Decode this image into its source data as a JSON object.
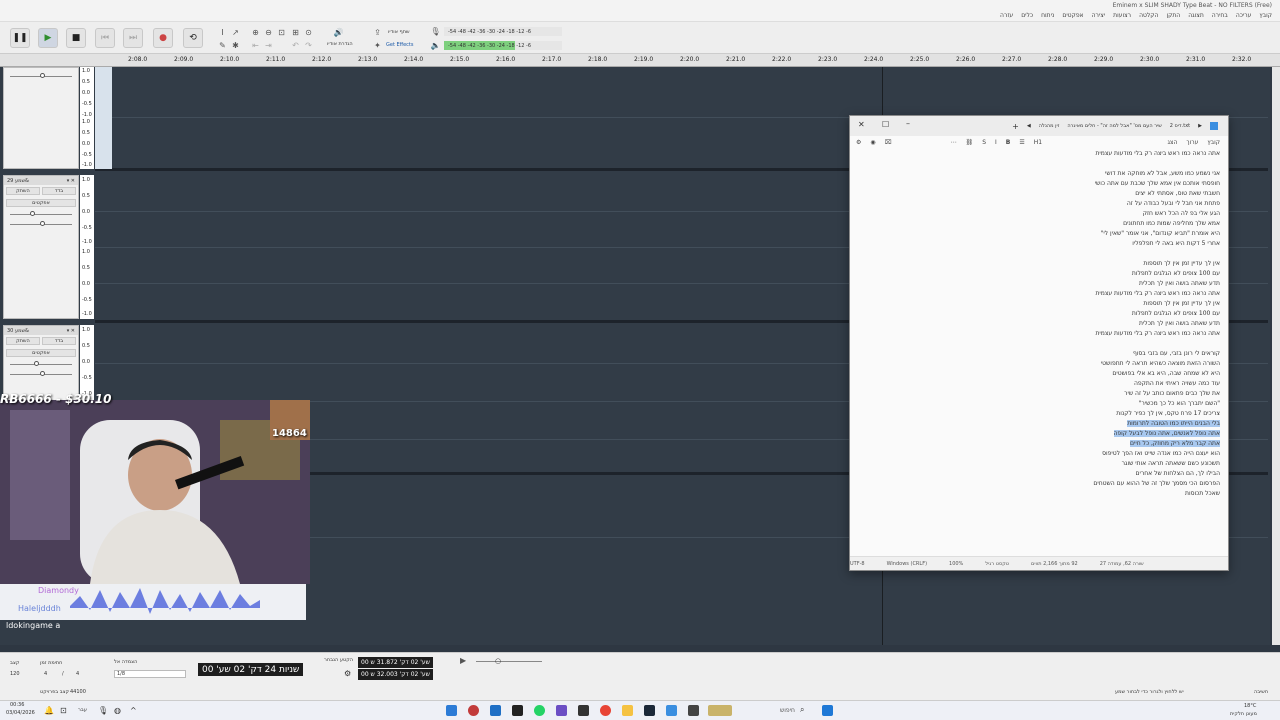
{
  "window_title": "(Free) Eminem x SLIM SHADY Type Beat - NO FILTERS",
  "menus": [
    "קובץ",
    "עריכה",
    "בחירה",
    "תצוגה",
    "התקן",
    "הקלטה",
    "רצועות",
    "יצירה",
    "אפקטים",
    "ניתוח",
    "כלים",
    "עזרה"
  ],
  "toolbar": {
    "share_audio": "שתף אודיו",
    "get_effects": "Get Effects",
    "audio_setup": "הגדרת אודיו",
    "meter_rec": "-54 -48 -42 -36 -30 -24 -18 -12 -6",
    "meter_play": "-54 -48 -42 -36 -30 -24 -18 -12 -6"
  },
  "ruler": [
    "2:08.0",
    "2:09.0",
    "2:10.0",
    "2:11.0",
    "2:12.0",
    "2:13.0",
    "2:14.0",
    "2:15.0",
    "2:16.0",
    "2:17.0",
    "2:18.0",
    "2:19.0",
    "2:20.0",
    "2:21.0",
    "2:22.0",
    "2:23.0",
    "2:24.0",
    "2:25.0",
    "2:26.0",
    "2:27.0",
    "2:28.0",
    "2:29.0",
    "2:30.0",
    "2:31.0",
    "2:32.0"
  ],
  "tracks": [
    {
      "name": "",
      "mute": "",
      "solo": "",
      "effects": "",
      "scale": [
        "1.0",
        "0.5",
        "0.0",
        "-0.5",
        "-1.0",
        "1.0",
        "0.5",
        "0.0",
        "-0.5",
        "-1.0"
      ]
    },
    {
      "name": "שמע 29&",
      "mute": "השתק",
      "solo": "בדד",
      "effects": "אפקטים",
      "scale": [
        "1.0",
        "0.5",
        "0.0",
        "-0.5",
        "-1.0",
        "1.0",
        "0.5",
        "0.0",
        "-0.5",
        "-1.0"
      ]
    },
    {
      "name": "שמע 30&",
      "mute": "השתק",
      "solo": "בדד",
      "effects": "אפקטים",
      "scale": [
        "1.0",
        "0.5",
        "0.0",
        "-0.5",
        "-1.0"
      ]
    }
  ],
  "notepad": {
    "tabs": [
      "דיס 2.txt",
      "שיר העם מס' \"אבל למה זה\" - חלים מאיגרה",
      "זין מהנלה"
    ],
    "menu": [
      "קובץ",
      "ערוך",
      "הצג"
    ],
    "heading": "H1",
    "lines": [
      "אתה נראה כמו ראש ביצה רק בלי מודעות עצמית",
      "",
      "אני נשמע כמו משע, אבל לא מוחקה את דושי",
      "חופסתי אותכם אין אמא שלך שכבת עם אתה כושי",
      "חשבתי שאת טוס, אסתתי לא יצים",
      "פתחת אני חבל לי ובעל כבודה על זה",
      "הגע אלי בפ לה הכל ראש חזק",
      "אמא שלך מחליפה שמות כמו תחתונים",
      "היא אומרת \"תביא קונדום\", אני אומר \"שאין לי\"",
      "אחרי 5 דקות היא באה לי תפלפליו",
      "",
      "אין לך עדיין זמן אין לך תוספות",
      "עם 100 צופים לא הגלגים לתפלות",
      "תדע שאתה בושה ואין לך תכלית",
      "אתה נראה כמו ראש ביצה רק בלי מודעות עצמית",
      "אין לך עדיין זמן אין לך תוספות",
      "עם 100 צופים לא הגלגים לתפלות",
      "תדע שאתה בושה ואין לך תכלית",
      "אתה נראה כמו ראש ביצה רק בלי מודעות עצמית",
      "",
      "קוראים לי רונן בזבי, עם בזבי בסוף",
      "השורה הזאת מוצאה כשהיא תראה לי תתפושטי",
      "היא לא שמחה שבה, היא בא אלי בפושטים",
      "עוד כמה עשויה ראיתי את התקפה",
      "את שלך כבים פתאום כותב על זה שיר",
      "\"השם יתברך הוא כל כך מכשיר\"",
      "צריכים 17 פרח טקס, אין לך כפיר לקנות",
      "בלי הבנים הייתו כמו הטובה לתרומות",
      "אתה נופל לאנשים, אתה נופל לבעל קופה",
      "אתה קבר מלא ריק מחוזק, כל חיים",
      "הוא יעצם הייה כמו אנדה שייט ואז הפך לטיפוס",
      "תשכונע כשם ששאתה תראה אותי שוגר",
      "הבילו לך, הם הצלחות של אחרים",
      "הפרסום הכי מסמך שלך זה של ההוא עם השטחים",
      "שאכל תכוסות"
    ],
    "highlight_from": 27,
    "highlight_to": 29,
    "status": [
      "שורה 62, עמודה 27",
      "92 מתוך 2,166 תווים",
      "טקסט רגיל",
      "100%",
      "Windows (CRLF)",
      "UTF-8"
    ]
  },
  "stream": {
    "viewer_tag": "RB6666 - $30.10",
    "side_count": "14864",
    "chat_user": "Diamondy",
    "chat_user2": "Haleljdddh",
    "channel": "ldokingame a"
  },
  "bottom": {
    "tempo_label": "קצב",
    "tempo": "120",
    "sig_label": "חתימת זמן",
    "sig_a": "4",
    "sig_b": "4",
    "snap_label": "הצמדה אל",
    "snap": "1/8",
    "time_main": "שניות 24 דק' 02 שע' 00",
    "sel_label": "הקטע הנבחר",
    "sel_start": "00 שע' 02 דק' 31.872 ש",
    "sel_end": "00 שע' 02 דק' 32.003 ש",
    "rate_label": "44100",
    "rate_text": "קצב בפרויקט",
    "status_hint": "יש ללחוץ ולגרור כדי לבחור שמע",
    "status_right": "חשיבה"
  },
  "taskbar": {
    "time": "00:36",
    "date": "03/04/2026",
    "lang": "עבר",
    "weather": "18°C",
    "weather_sub": "מעונן חלקית",
    "search": "חיפוש"
  },
  "colors": {
    "selection": "#a8c8ef",
    "track_bg": "#323c47",
    "play_green": "#2f8e2f"
  }
}
